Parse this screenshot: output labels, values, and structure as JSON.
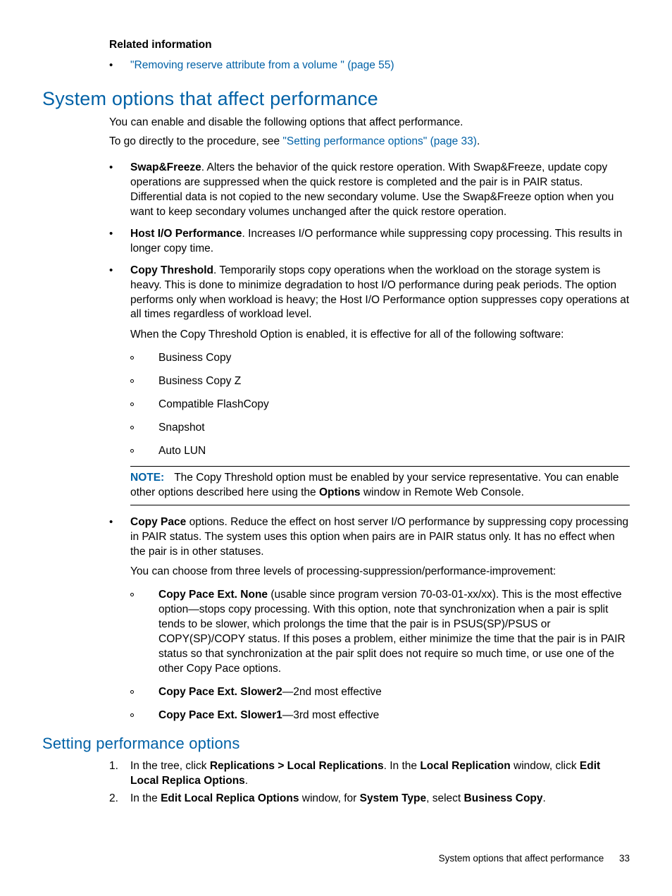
{
  "related": {
    "heading": "Related information",
    "items": [
      "\"Removing reserve attribute from a volume \" (page 55)"
    ]
  },
  "section1": {
    "title": "System options that affect performance",
    "intro1": "You can enable and disable the following options that affect performance.",
    "intro2_pre": "To go directly to the procedure, see ",
    "intro2_link": "\"Setting performance options\" (page 33)",
    "intro2_post": "."
  },
  "opts": {
    "swap": {
      "label": "Swap&Freeze",
      "text": ". Alters the behavior of the quick restore operation. With Swap&Freeze, update copy operations are suppressed when the quick restore is completed and the pair is in PAIR status. Differential data is not copied to the new secondary volume. Use the Swap&Freeze option when you want to keep secondary volumes unchanged after the quick restore operation."
    },
    "hostio": {
      "label": "Host I/O Performance",
      "text": ". Increases I/O performance while suppressing copy processing. This results in longer copy time."
    },
    "copythresh": {
      "label": "Copy Threshold",
      "text": ". Temporarily stops copy operations when the workload on the storage system is heavy. This is done to minimize degradation to host I/O performance during peak periods. The option performs only when workload is heavy; the Host I/O Performance option suppresses copy operations at all times regardless of workload level.",
      "para2": "When the Copy Threshold Option is enabled, it is effective for all of the following software:",
      "software": [
        "Business Copy",
        "Business Copy Z",
        "Compatible FlashCopy",
        "Snapshot",
        "Auto LUN"
      ]
    },
    "note": {
      "label": "NOTE:",
      "text_pre": "The Copy Threshold option must be enabled by your service representative. You can enable other options described here using the ",
      "bold": "Options",
      "text_post": " window in Remote Web Console."
    },
    "copypace": {
      "label": "Copy Pace",
      "text": " options. Reduce the effect on host server I/O performance by suppressing copy processing in PAIR status. The system uses this option when pairs are in PAIR status only. It has no effect when the pair is in other statuses.",
      "para2": "You can choose from three levels of processing-suppression/performance-improvement:",
      "levels": {
        "none": {
          "label": "Copy Pace Ext. None",
          "text": " (usable since program version 70-03-01-xx/xx). This is the most effective option—stops copy processing. With this option, note that synchronization when a pair is split tends to be slower, which prolongs the time that the pair is in PSUS(SP)/PSUS or COPY(SP)/COPY status. If this poses a problem, either minimize the time that the pair is in PAIR status so that synchronization at the pair split does not require so much time, or use one of the other Copy Pace options."
        },
        "slower2": {
          "label": "Copy Pace Ext. Slower2",
          "text": "—2nd most effective"
        },
        "slower1": {
          "label": "Copy Pace Ext. Slower1",
          "text": "—3rd most effective"
        }
      }
    }
  },
  "section2": {
    "title": "Setting performance options",
    "steps": {
      "s1": {
        "num": "1.",
        "pre": "In the tree, click ",
        "b1": "Replications > Local Replications",
        "mid": ". In the ",
        "b2": "Local Replication",
        "mid2": " window, click ",
        "b3": "Edit Local Replica Options",
        "post": "."
      },
      "s2": {
        "num": "2.",
        "pre": "In the ",
        "b1": "Edit Local Replica Options",
        "mid": " window, for ",
        "b2": "System Type",
        "mid2": ", select ",
        "b3": "Business Copy",
        "post": "."
      }
    }
  },
  "footer": {
    "text": "System options that affect performance",
    "page": "33"
  }
}
